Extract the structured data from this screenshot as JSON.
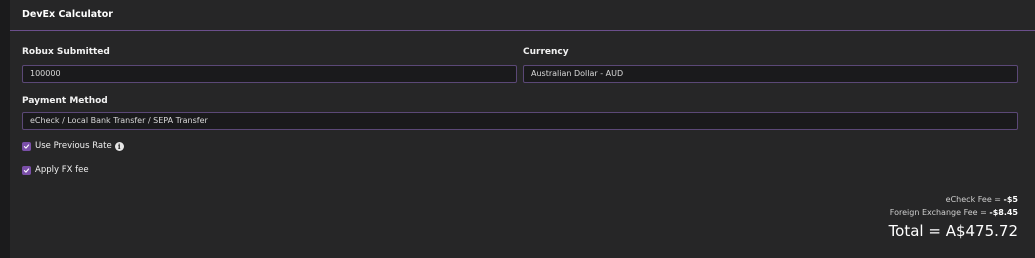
{
  "panel": {
    "title": "DevEx Calculator"
  },
  "fields": {
    "robux": {
      "label": "Robux Submitted",
      "value": "100000"
    },
    "currency": {
      "label": "Currency",
      "value": "Australian Dollar - AUD"
    },
    "payment": {
      "label": "Payment Method",
      "value": "eCheck / Local Bank Transfer / SEPA Transfer"
    }
  },
  "options": {
    "previous_rate": {
      "label": "Use Previous Rate",
      "checked": true
    },
    "fx_fee": {
      "label": "Apply FX fee",
      "checked": true
    }
  },
  "fees": {
    "echeck_label": "eCheck Fee = ",
    "echeck_value": "-$5",
    "fx_label": "Foreign Exchange Fee = ",
    "fx_value": "-$8.45"
  },
  "total": {
    "label": "Total = ",
    "value": "A$475.72"
  },
  "colors": {
    "accent": "#7a4fa8",
    "panel": "#262627",
    "input_border": "#5b4877"
  }
}
